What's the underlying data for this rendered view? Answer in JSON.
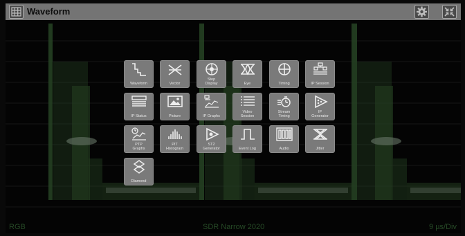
{
  "window": {
    "title": "Waveform"
  },
  "footer": {
    "color_space": "RGB",
    "standard": "SDR Narrow 2020",
    "timebase": "9 µs/Div"
  },
  "menu": {
    "tiles": [
      {
        "label": "Waveform",
        "icon": "waveform-icon"
      },
      {
        "label": "Vector",
        "icon": "vector-icon"
      },
      {
        "label": "Stop\nDisplay",
        "icon": "stop-display-icon"
      },
      {
        "label": "Eye",
        "icon": "eye-icon"
      },
      {
        "label": "Timing",
        "icon": "timing-icon"
      },
      {
        "label": "IP Session",
        "icon": "ip-session-icon"
      },
      {
        "label": "IP Status",
        "icon": "ip-status-icon"
      },
      {
        "label": "Picture",
        "icon": "picture-icon"
      },
      {
        "label": "IP Graphs",
        "icon": "ip-graphs-icon"
      },
      {
        "label": "Video\nSession",
        "icon": "video-session-icon"
      },
      {
        "label": "Stream\nTiming",
        "icon": "stream-timing-icon"
      },
      {
        "label": "IP\nGenerator",
        "icon": "ip-generator-icon"
      },
      {
        "label": "PTP\nGraphs",
        "icon": "ptp-graphs-icon"
      },
      {
        "label": "PIT\nHistogram",
        "icon": "pit-histogram-icon"
      },
      {
        "label": "ST2\nGenerator",
        "icon": "st2-generator-icon"
      },
      {
        "label": "Event Log",
        "icon": "event-log-icon"
      },
      {
        "label": "Audio",
        "icon": "audio-icon"
      },
      {
        "label": "Jitter",
        "icon": "jitter-icon"
      },
      {
        "label": "Diamond",
        "icon": "diamond-icon"
      }
    ]
  }
}
